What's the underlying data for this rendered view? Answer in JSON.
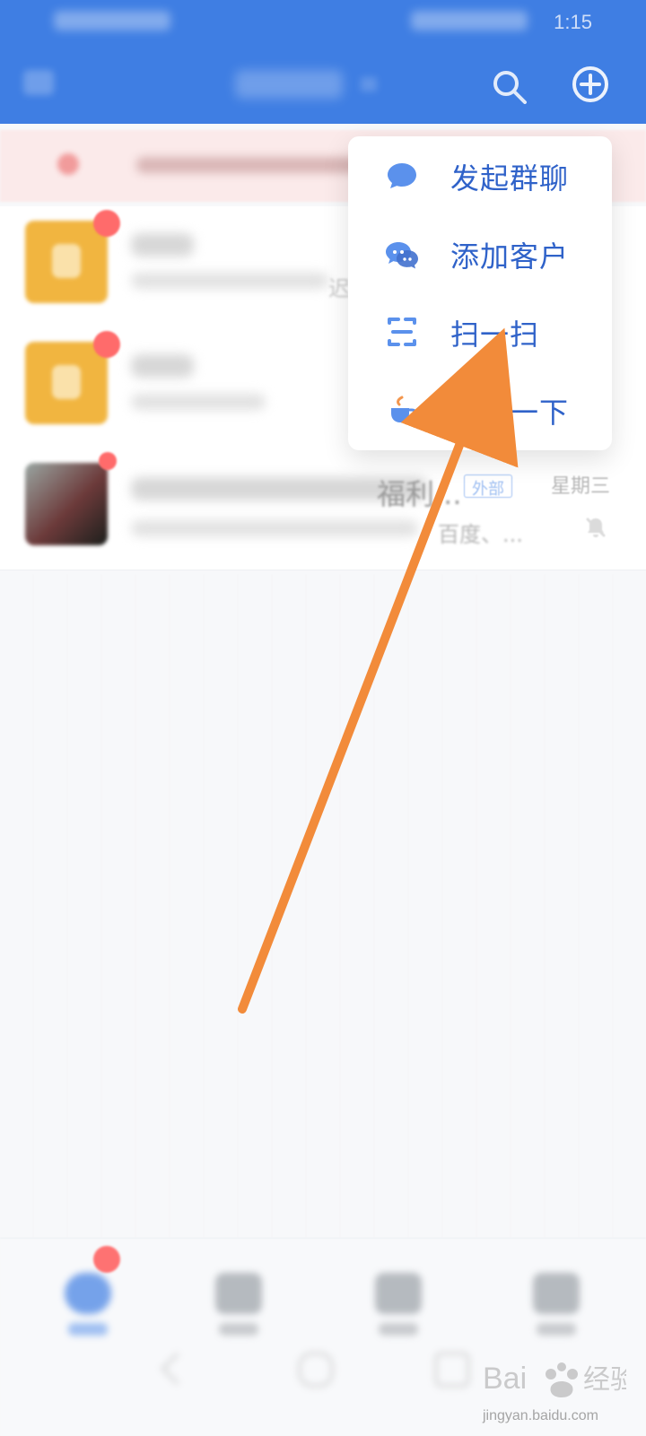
{
  "status_bar": {
    "time": "1:15"
  },
  "menu": {
    "items": [
      {
        "label": "发起群聊",
        "icon": "chat-bubble-icon"
      },
      {
        "label": "添加客户",
        "icon": "wechat-icon"
      },
      {
        "label": "扫一扫",
        "icon": "scan-icon"
      },
      {
        "label": "休息一下",
        "icon": "coffee-cup-icon"
      }
    ]
  },
  "chat_list": {
    "row1": {
      "late_text": "迟"
    },
    "row3": {
      "title_tail": "福利...",
      "external_tag": "外部",
      "time": "星期三",
      "snippet_tail": "百度、..."
    }
  },
  "colors": {
    "header_blue": "#3f7ee3",
    "menu_text_blue": "#2f62c9",
    "arrow_orange": "#f28b3a"
  },
  "watermark": {
    "brand": "Bai 经验",
    "url": "jingyan.baidu.com"
  }
}
